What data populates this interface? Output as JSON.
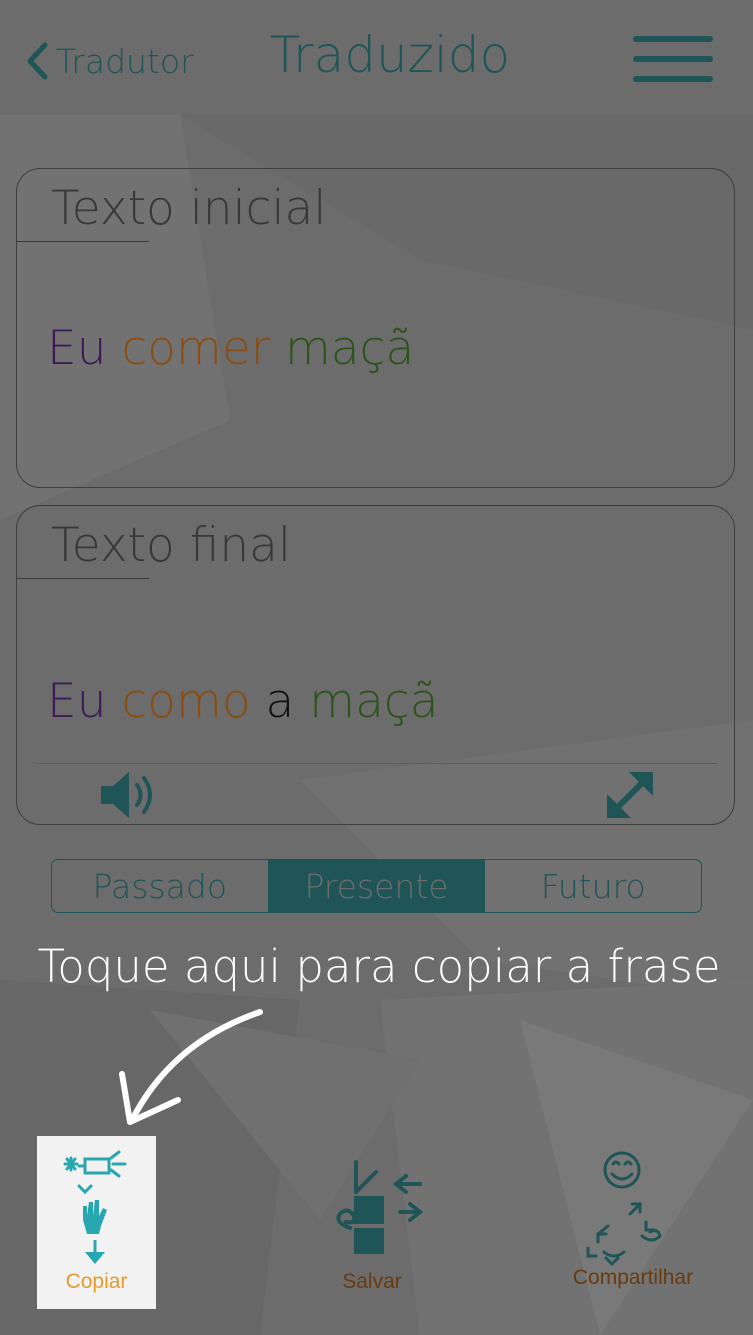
{
  "header": {
    "back_label": "Tradutor",
    "title": "Traduzido"
  },
  "initial_card": {
    "label": "Texto inicial",
    "words": [
      {
        "text": "Eu",
        "role": "subject"
      },
      {
        "text": "comer",
        "role": "verb"
      },
      {
        "text": "maçã",
        "role": "object"
      }
    ]
  },
  "final_card": {
    "label": "Texto final",
    "words": [
      {
        "text": "Eu",
        "role": "subject"
      },
      {
        "text": "como",
        "role": "verb"
      },
      {
        "text": "a",
        "role": "article"
      },
      {
        "text": "maçã",
        "role": "object"
      }
    ]
  },
  "tense": {
    "options": [
      "Passado",
      "Presente",
      "Futuro"
    ],
    "selected": "Presente"
  },
  "hint": "Toque aqui para copiar a frase",
  "actions": {
    "copy_label": "Copiar",
    "save_label": "Salvar",
    "share_label": "Compartilhar"
  },
  "colors": {
    "accent": "#1f5556",
    "subject": "#3d1a58",
    "verb": "#8a4d12",
    "object": "#2c541a",
    "copy_label": "#e69a2e",
    "icon_teal": "#29a7b0"
  }
}
